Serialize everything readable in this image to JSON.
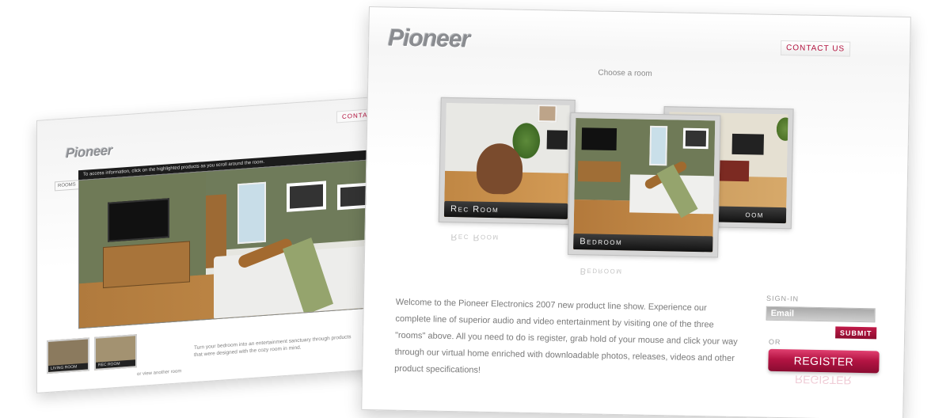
{
  "back_screen": {
    "logo": "Pioneer",
    "contact_label": "CONTAC",
    "tip": "To access information, click on the highlighted products as you scroll around the room.",
    "side_label": "ROOMS",
    "thumbnails": [
      {
        "label": "LIVING ROOM"
      },
      {
        "label": "REC ROOM"
      }
    ],
    "caption": "Turn your bedroom into an entertainment sanctuary through products that were designed with the cozy room in mind.",
    "more_text": "or view another room"
  },
  "front_screen": {
    "logo": "Pioneer",
    "contact_label": "CONTACT US",
    "choose_label": "Choose a room",
    "rooms": [
      {
        "label": "Rec Room"
      },
      {
        "label": "Bedroom"
      },
      {
        "label": "Living Room",
        "visible_label": "oom"
      }
    ],
    "welcome_text": "Welcome to the Pioneer Electronics 2007 new product line show. Experience our complete line of superior audio and video entertainment by visiting one of the three \"rooms\" above. All you need to do is register, grab hold of your mouse and click your way through our virtual home enriched with downloadable photos, releases, videos and other product specifications!",
    "signin": {
      "label": "SIGN-IN",
      "email_placeholder": "Email",
      "submit_label": "SUBMIT",
      "or_label": "OR",
      "register_label": "REGISTER"
    }
  },
  "colors": {
    "brand_red": "#b3123e",
    "logo_gray": "#8a8c90"
  }
}
